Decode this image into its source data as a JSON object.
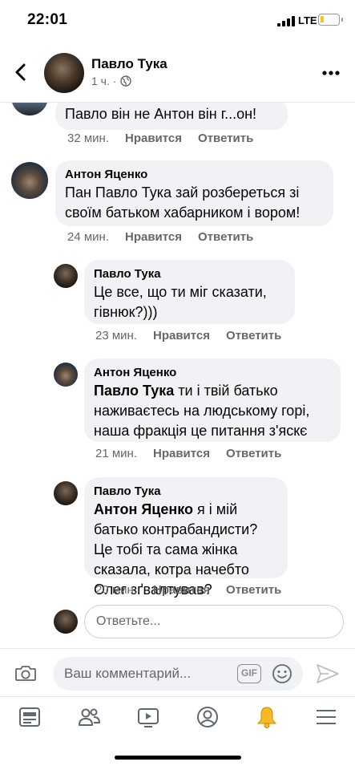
{
  "status_bar": {
    "time": "22:01",
    "network": "LTE"
  },
  "header": {
    "name": "Павло Тука",
    "meta": "1 ч. ·"
  },
  "comments": [
    {
      "name": "",
      "text": "Павло він не Антон він г...он!",
      "time": "32 мин.",
      "like": "Нравится",
      "reply": "Ответить"
    },
    {
      "name": "Антон Яценко",
      "text": "Пан Павло Тука зай розбереться зі своїм батьком хабарником і вором!",
      "time": "24 мин.",
      "like": "Нравится",
      "reply": "Ответить"
    },
    {
      "name": "Павло Тука",
      "text": "Це все, що ти міг сказати, гівнюк?)))",
      "time": "23 мин.",
      "like": "Нравится",
      "reply": "Ответить"
    },
    {
      "name": "Антон Яценко",
      "mention": "Павло Тука",
      "text": "  ти і твій батько наживаєтесь на людському горі, наша фракція це питання з'яскє",
      "time": "21 мин.",
      "like": "Нравится",
      "reply": "Ответить"
    },
    {
      "name": "Павло Тука",
      "mention": "Антон Яценко",
      "text": " я і мій батько контрабандисти? Це тобі та сама жінка сказала, котра начебто Олег зґвалтував?",
      "time": "20 мин.",
      "like": "Нравится",
      "reply": "Ответить"
    }
  ],
  "reply_placeholder": "Ответьте...",
  "composer": {
    "placeholder": "Ваш комментарий...",
    "gif_label": "GIF"
  },
  "tabs": [
    "news-feed-icon",
    "friends-icon",
    "watch-icon",
    "profile-icon",
    "notifications-bell-icon",
    "menu-icon"
  ],
  "colors": {
    "accent_bell": "#f7b928",
    "bubble": "#f0f2f5",
    "secondary_text": "#65676b"
  }
}
